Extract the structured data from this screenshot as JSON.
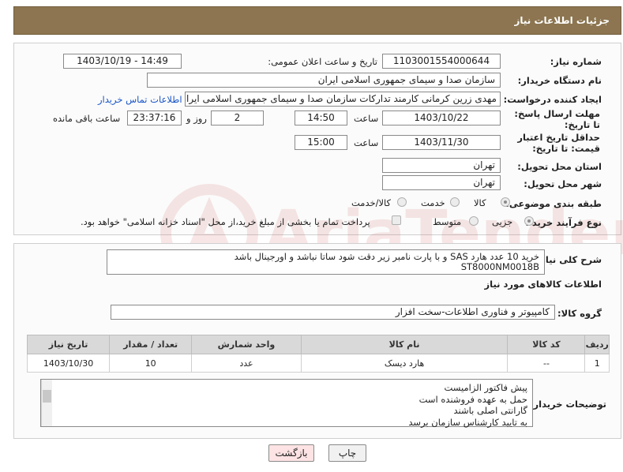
{
  "header": {
    "title": "جزئیات اطلاعات نیاز"
  },
  "fields": {
    "need_number_label": "شماره نیاز:",
    "need_number": "1103001554000644",
    "announce_label": "تاریخ و ساعت اعلان عمومی:",
    "announce_value": "1403/10/19 - 14:49",
    "buyer_org_label": "نام دستگاه خریدار:",
    "buyer_org": "سازمان صدا و سیمای جمهوری اسلامی ایران",
    "creator_label": "ایجاد کننده درخواست:",
    "creator": "مهدی زرین کرمانی کارمند تدارکات سازمان صدا و سیمای جمهوری اسلامی ایران",
    "contact_link": "اطلاعات تماس خریدار",
    "deadline_label": "مهلت ارسال پاسخ: تا تاریخ:",
    "deadline_date": "1403/10/22",
    "time_label": "ساعت",
    "deadline_time": "14:50",
    "days_value": "2",
    "days_label": "روز و",
    "remaining_value": "23:37:16",
    "remaining_label": "ساعت باقی مانده",
    "validity_label": "حداقل تاریخ اعتبار قیمت: تا تاریخ:",
    "validity_date": "1403/11/30",
    "validity_time_label": "ساعت",
    "validity_time": "15:00",
    "province_label": "استان محل تحویل:",
    "province": "تهران",
    "city_label": "شهر محل تحویل:",
    "city": "تهران",
    "category_label": "طبقه بندی موضوعی:",
    "category_options": [
      "کالا",
      "خدمت",
      "کالا/خدمت"
    ],
    "process_label": "نوع فرآیند خرید :",
    "process_options": [
      "جزیی",
      "متوسط"
    ],
    "payment_note": "پرداخت تمام یا بخشی از مبلغ خرید،از محل \"اسناد خزانه اسلامی\" خواهد بود."
  },
  "description": {
    "label": "شرح کلی نیاز:",
    "line1": "خرید 10 عدد هارد SAS و با پارت نامبر زیر دقت شود ساتا نباشد و اورجینال باشد",
    "line2": "ST8000NM0018B"
  },
  "goods": {
    "section_title": "اطلاعات کالاهای مورد نیاز",
    "group_label": "گروه کالا:",
    "group_value": "کامپیوتر و فناوری اطلاعات-سخت افزار",
    "headers": [
      "ردیف",
      "کد کالا",
      "نام کالا",
      "واحد شمارش",
      "تعداد / مقدار",
      "تاریخ نیاز"
    ],
    "rows": [
      {
        "row": "1",
        "code": "--",
        "name": "هارد دیسک",
        "unit": "عدد",
        "qty": "10",
        "date": "1403/10/30"
      }
    ]
  },
  "buyer_notes": {
    "label": "توضیحات خریدار:",
    "lines": [
      "پیش فاکتور الزامیست",
      "حمل به عهده فروشنده است",
      "گارانتی اصلی باشند",
      "به تایید کارشناس سازمان برسد"
    ]
  },
  "buttons": {
    "print": "چاپ",
    "back": "بازگشت"
  },
  "colors": {
    "header_bg": "#8c7550",
    "link": "#1a55c8",
    "back_button_bg": "#fde3e3",
    "watermark": "#c62828"
  }
}
